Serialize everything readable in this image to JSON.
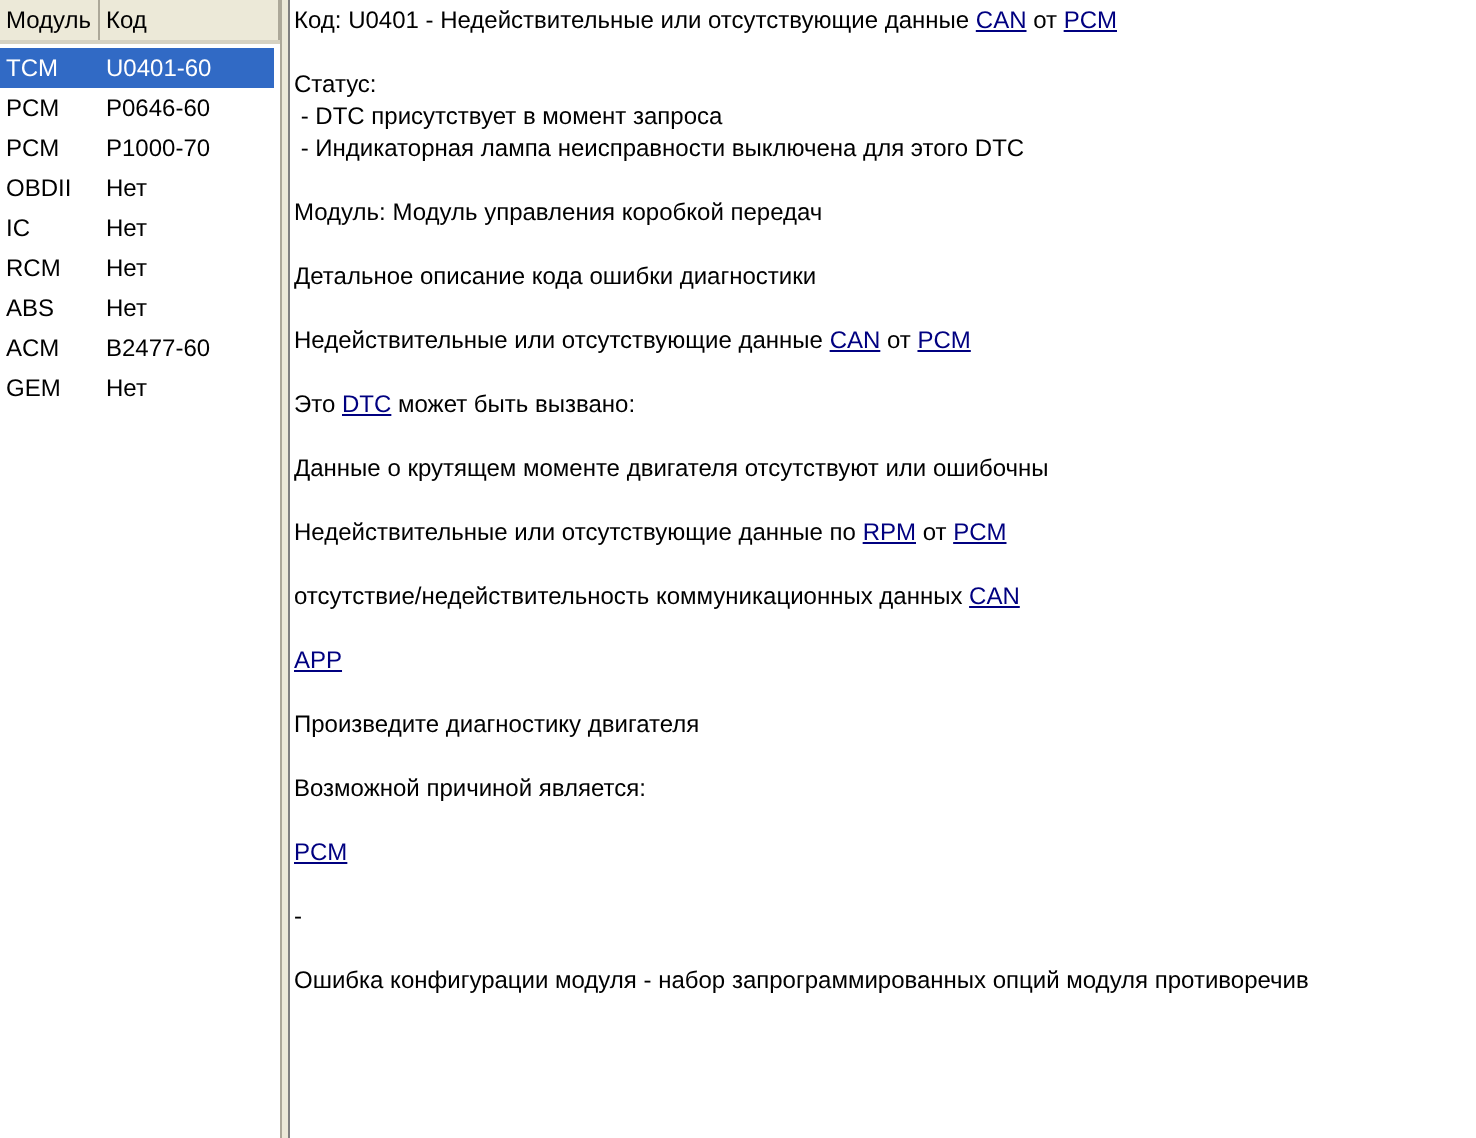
{
  "table": {
    "columns": [
      "Модуль",
      "Код"
    ],
    "rows": [
      {
        "cells": [
          "TCM",
          "U0401-60"
        ],
        "selected": true
      },
      {
        "cells": [
          "PCM",
          "P0646-60"
        ],
        "selected": false
      },
      {
        "cells": [
          "PCM",
          "P1000-70"
        ],
        "selected": false
      },
      {
        "cells": [
          "OBDII",
          "Нет"
        ],
        "selected": false
      },
      {
        "cells": [
          "IC",
          "Нет"
        ],
        "selected": false
      },
      {
        "cells": [
          "RCM",
          "Нет"
        ],
        "selected": false
      },
      {
        "cells": [
          "ABS",
          "Нет"
        ],
        "selected": false
      },
      {
        "cells": [
          "ACM",
          "B2477-60"
        ],
        "selected": false
      },
      {
        "cells": [
          "GEM",
          "Нет"
        ],
        "selected": false
      }
    ]
  },
  "details": [
    [
      [
        {
          "text": "Код: U0401 - Недействительные или отсутствующие данные "
        },
        {
          "link": "CAN"
        },
        {
          "text": " от "
        },
        {
          "link": "PCM"
        }
      ]
    ],
    [
      [
        {
          "text": "Статус:"
        }
      ],
      [
        {
          "text": " - DTC присутствует в момент запроса"
        }
      ],
      [
        {
          "text": " - Индикаторная лампа неисправности выключена для этого DTC"
        }
      ]
    ],
    [
      [
        {
          "text": "Модуль: Модуль управления коробкой передач"
        }
      ]
    ],
    [
      [
        {
          "text": "Детальное описание кода ошибки диагностики"
        }
      ]
    ],
    [
      [
        {
          "text": "Недействительные или отсутствующие данные "
        },
        {
          "link": "CAN"
        },
        {
          "text": " от "
        },
        {
          "link": "PCM"
        }
      ]
    ],
    [
      [
        {
          "text": "Это "
        },
        {
          "link": "DTC"
        },
        {
          "text": " может быть вызвано:"
        }
      ]
    ],
    [
      [
        {
          "text": "Данные о крутящем моменте двигателя отсутствуют или ошибочны"
        }
      ]
    ],
    [
      [
        {
          "text": "Недействительные или отсутствующие данные по "
        },
        {
          "link": "RPM"
        },
        {
          "text": " от "
        },
        {
          "link": "PCM"
        }
      ]
    ],
    [
      [
        {
          "text": "отсутствие/недействительность коммуникационных данных "
        },
        {
          "link": "CAN"
        }
      ]
    ],
    [
      [
        {
          "link": "APP"
        }
      ]
    ],
    [
      [
        {
          "text": "Произведите диагностику двигателя"
        }
      ]
    ],
    [
      [
        {
          "text": "Возможной причиной является:"
        }
      ]
    ],
    [
      [
        {
          "link": "PCM"
        }
      ]
    ],
    [
      [
        {
          "text": "-"
        }
      ]
    ],
    [
      [
        {
          "text": "Ошибка конфигурации модуля - набор запрограммированных опций модуля противоречив"
        }
      ]
    ]
  ]
}
